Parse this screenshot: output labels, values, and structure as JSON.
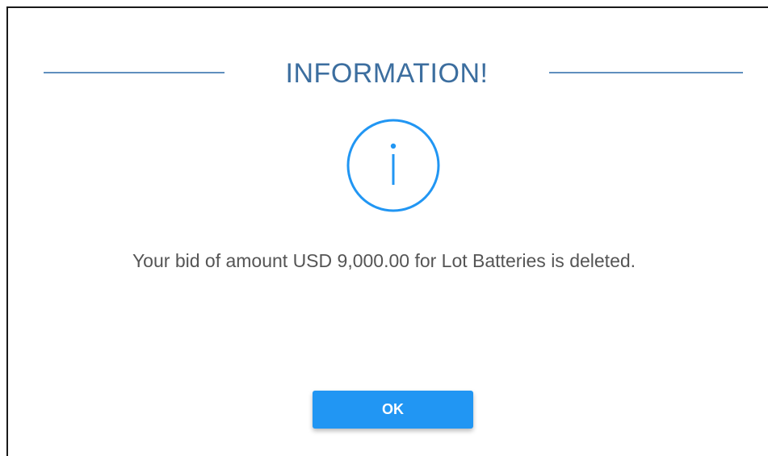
{
  "dialog": {
    "title": "INFORMATION!",
    "icon": "info-icon",
    "message": "Your bid of amount USD 9,000.00 for Lot Batteries is deleted.",
    "ok_label": "OK"
  },
  "colors": {
    "title": "#3c6e9f",
    "rule": "#5f8fbe",
    "icon": "#2196f3",
    "message": "#555555",
    "button": "#2196f3",
    "button_text": "#ffffff",
    "frame": "#1a1a1a"
  }
}
